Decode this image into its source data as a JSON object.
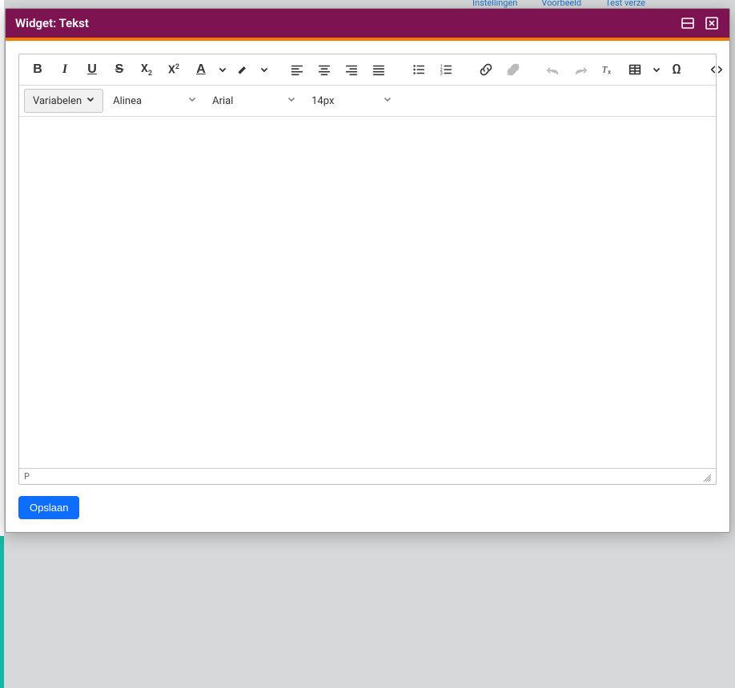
{
  "background_buttons": [
    "Instellingen",
    "Voorbeeld",
    "Test verze"
  ],
  "dialog": {
    "title": "Widget: Tekst"
  },
  "toolbar": {
    "variables_label": "Variabelen",
    "block_format": "Alinea",
    "font_family": "Arial",
    "font_size": "14px"
  },
  "status": {
    "path": "P"
  },
  "footer": {
    "save_label": "Opslaan"
  }
}
